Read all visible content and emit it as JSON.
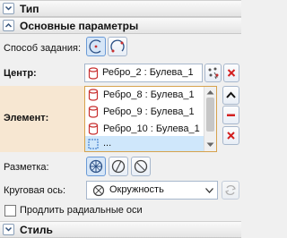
{
  "sections": {
    "type_title": "Тип",
    "basic_title": "Основные параметры",
    "style_title": "Стиль"
  },
  "method": {
    "label": "Способ задания:"
  },
  "center": {
    "label": "Центр:",
    "value": "Ребро_2 : Булева_1"
  },
  "element": {
    "label": "Элемент:",
    "items": [
      "Ребро_8 : Булева_1",
      "Ребро_9 : Булева_1",
      "Ребро_10 : Булева_1"
    ],
    "new_item_text": "..."
  },
  "markup": {
    "label": "Разметка:"
  },
  "circular_axis": {
    "label": "Круговая ось:",
    "value": "Окружность"
  },
  "extend_radial": {
    "label": "Продлить радиальные оси",
    "checked": false
  },
  "colors": {
    "accent": "#2b6cc4",
    "delete": "#d32020",
    "item_icon": "#c83030",
    "highlight": "#f7e7d2"
  }
}
